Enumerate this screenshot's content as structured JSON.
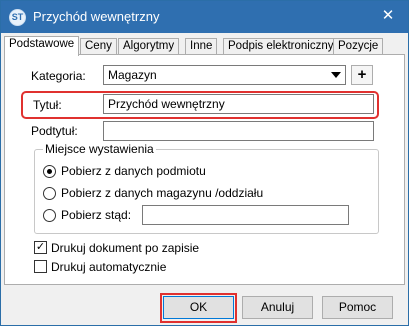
{
  "window": {
    "title": "Przychód wewnętrzny",
    "icon": "app-logo-icon",
    "icon_text": "ST",
    "close_symbol": "✕"
  },
  "tabs": [
    {
      "label": "Podstawowe",
      "active": true
    },
    {
      "label": "Ceny"
    },
    {
      "label": "Algorytmy"
    },
    {
      "label": "Inne"
    },
    {
      "label": "Podpis elektroniczny"
    },
    {
      "label": "Pozycje"
    }
  ],
  "form": {
    "kategoria_label": "Kategoria:",
    "kategoria_value": "Magazyn",
    "add_symbol": "+",
    "tytul_label": "Tytuł:",
    "tytul_value": "Przychód wewnętrzny",
    "podtytul_label": "Podtytuł:",
    "podtytul_value": ""
  },
  "miejsce": {
    "title": "Miejsce wystawienia",
    "options": [
      {
        "label": "Pobierz z danych podmiotu",
        "selected": true
      },
      {
        "label": "Pobierz z danych magazynu /oddziału",
        "selected": false
      },
      {
        "label": "Pobierz stąd:",
        "selected": false
      }
    ],
    "stad_value": ""
  },
  "checkboxes": {
    "drukuj_po_zapisie": {
      "label": "Drukuj dokument po zapisie",
      "checked": true
    },
    "drukuj_auto": {
      "label": "Drukuj automatycznie",
      "checked": false
    }
  },
  "buttons": {
    "ok": "OK",
    "anuluj": "Anuluj",
    "pomoc": "Pomoc"
  },
  "colors": {
    "titlebar": "#2f6fb0",
    "highlight": "#e0312f"
  }
}
